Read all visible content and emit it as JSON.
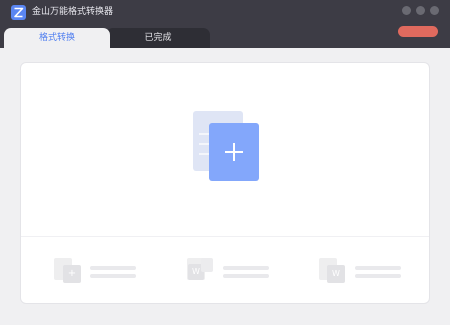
{
  "app": {
    "title": "金山万能格式转换器",
    "logo_icon": "z-logo-icon"
  },
  "tabs": [
    {
      "label": "格式转换",
      "active": true
    },
    {
      "label": "已完成",
      "active": false
    }
  ],
  "colors": {
    "accent": "#4f7ef0",
    "titlebar": "#3d3c45",
    "action_button": "#e06a5e",
    "add_file_icon": "#83a7fb"
  },
  "main": {
    "add_icon": "add-file-icon"
  },
  "features": [
    {
      "icon": "add-document-icon"
    },
    {
      "icon": "word-convert-icon"
    },
    {
      "icon": "pdf-to-word-icon"
    }
  ]
}
